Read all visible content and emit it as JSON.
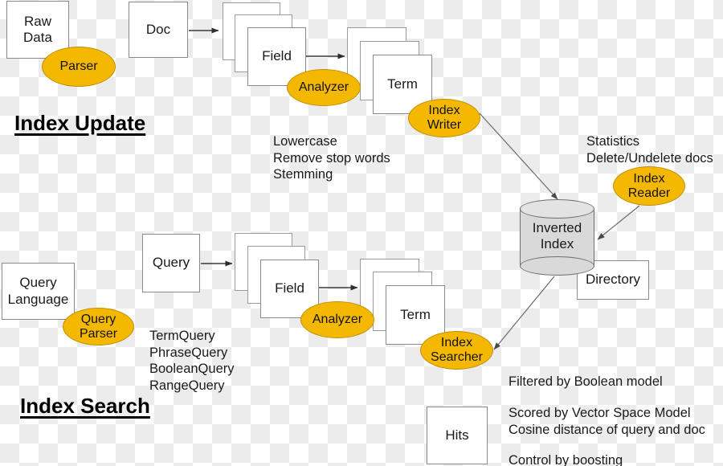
{
  "diagram": {
    "title_index_update": "Index Update",
    "title_index_search": "Index Search",
    "boxes": {
      "raw_data": "Raw\nData",
      "doc": "Doc",
      "field_top": "Field",
      "term_top": "Term",
      "query_language": "Query\nLanguage",
      "query": "Query",
      "field_bottom": "Field",
      "term_bottom": "Term",
      "directory": "Directory",
      "hits": "Hits"
    },
    "cylinder": {
      "label": "Inverted\nIndex"
    },
    "ellipses": {
      "parser": "Parser",
      "analyzer_top": "Analyzer",
      "index_writer": "Index\nWriter",
      "index_reader": "Index\nReader",
      "query_parser": "Query\nParser",
      "analyzer_bottom": "Analyzer",
      "index_searcher": "Index\nSearcher"
    },
    "notes": {
      "analyzer_steps": "Lowercase\nRemove stop words\nStemming",
      "reader_ops": "Statistics\nDelete/Undelete docs",
      "query_types": "TermQuery\nPhraseQuery\nBooleanQuery\nRangeQuery",
      "filtered": "Filtered by Boolean model",
      "scored": "Scored by Vector Space Model\nCosine distance of query and doc",
      "boosting": "Control by boosting"
    },
    "colors": {
      "accent_yellow": "#f5b800",
      "accent_yellow_border": "#c08f00",
      "box_border": "#8a8a8a",
      "cylinder_fill": "#d9d9d9",
      "arrow": "#4d4d4d",
      "text": "#1a1a1a"
    }
  }
}
